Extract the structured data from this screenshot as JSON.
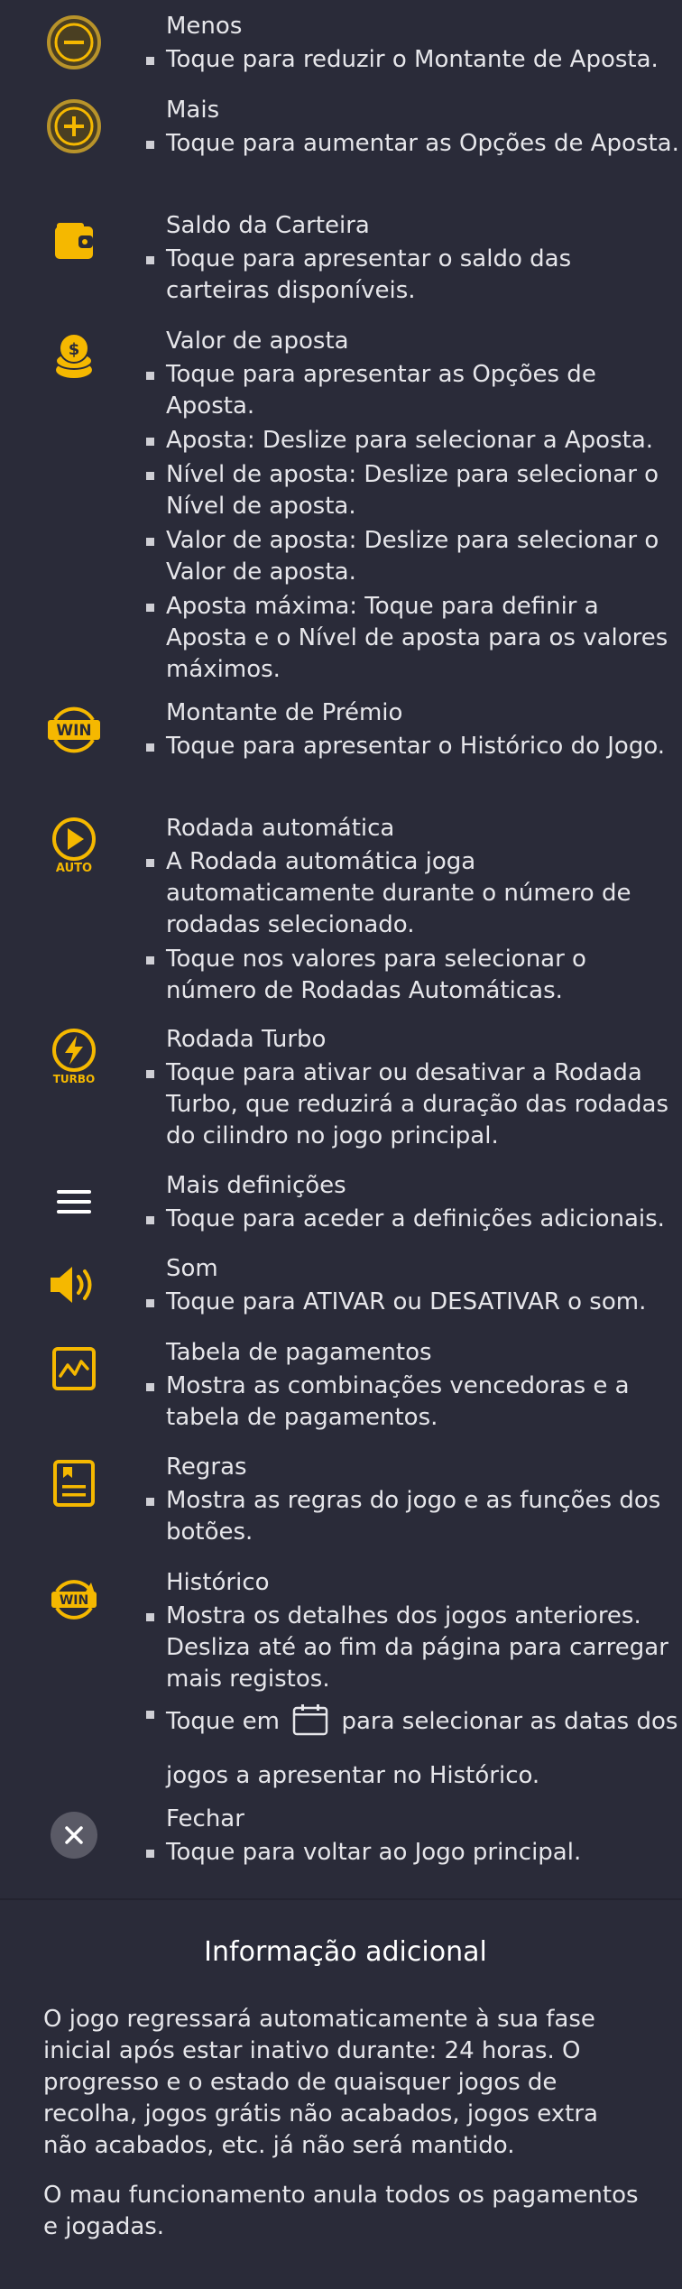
{
  "colors": {
    "background": "#2a2b39",
    "accent": "#f5b800",
    "text": "#e6e6ea"
  },
  "items": [
    {
      "icon": "minus-circle-icon",
      "title": "Menos",
      "bullets": [
        "Toque para reduzir o Montante de Aposta."
      ]
    },
    {
      "icon": "plus-circle-icon",
      "title": "Mais",
      "bullets": [
        "Toque para aumentar as Opções de Aposta."
      ]
    },
    {
      "icon": "wallet-icon",
      "title": "Saldo da Carteira",
      "bullets": [
        "Toque para apresentar o saldo das carteiras disponíveis."
      ]
    },
    {
      "icon": "coins-icon",
      "title": "Valor de aposta",
      "bullets": [
        "Toque para apresentar as Opções de Aposta.",
        "Aposta: Deslize para selecionar a Aposta.",
        "Nível de aposta: Deslize para selecionar o Nível de aposta.",
        "Valor de aposta: Deslize para selecionar o Valor de aposta.",
        "Aposta máxima: Toque para definir a Aposta e o Nível de aposta para os valores máximos."
      ]
    },
    {
      "icon": "win-badge-icon",
      "title": "Montante de Prémio",
      "bullets": [
        "Toque para apresentar o Histórico do Jogo."
      ]
    },
    {
      "icon": "auto-play-icon",
      "icon_label": "AUTO",
      "title": "Rodada automática",
      "bullets": [
        "A Rodada automática joga automaticamente durante o número de rodadas selecionado.",
        "Toque nos valores para selecionar o número de Rodadas Automáticas."
      ]
    },
    {
      "icon": "turbo-icon",
      "icon_label": "TURBO",
      "title": "Rodada Turbo",
      "bullets": [
        "Toque para ativar ou desativar a Rodada Turbo, que reduzirá a duração das rodadas do cilindro no jogo principal."
      ]
    },
    {
      "icon": "menu-icon",
      "title": "Mais definições",
      "bullets": [
        "Toque para aceder a definições adicionais."
      ]
    },
    {
      "icon": "sound-icon",
      "title": "Som",
      "bullets": [
        "Toque para ATIVAR ou DESATIVAR o som."
      ]
    },
    {
      "icon": "paytable-icon",
      "title": "Tabela de pagamentos",
      "bullets": [
        "Mostra as combinações vencedoras e a tabela de pagamentos."
      ]
    },
    {
      "icon": "rules-icon",
      "title": "Regras",
      "bullets": [
        "Mostra as regras do jogo e as funções dos botões."
      ]
    },
    {
      "icon": "history-icon",
      "title": "Histórico",
      "bullets": [
        "Mostra os detalhes dos jogos anteriores. Desliza até ao fim da página para carregar mais registos."
      ],
      "extra_before": "Toque em",
      "extra_after": "para selecionar as datas dos jogos a apresentar no Histórico."
    },
    {
      "icon": "close-icon",
      "title": "Fechar",
      "bullets": [
        "Toque para voltar ao Jogo principal."
      ]
    }
  ],
  "win_text": "WIN",
  "info": {
    "heading": "Informação adicional",
    "paragraphs": [
      "O jogo regressará automaticamente à sua fase inicial após estar inativo durante: 24 horas. O progresso e o estado de quaisquer jogos de recolha, jogos grátis não acabados, jogos extra não acabados, etc. já não será mantido.",
      "O mau funcionamento anula todos os pagamentos e jogadas."
    ]
  }
}
